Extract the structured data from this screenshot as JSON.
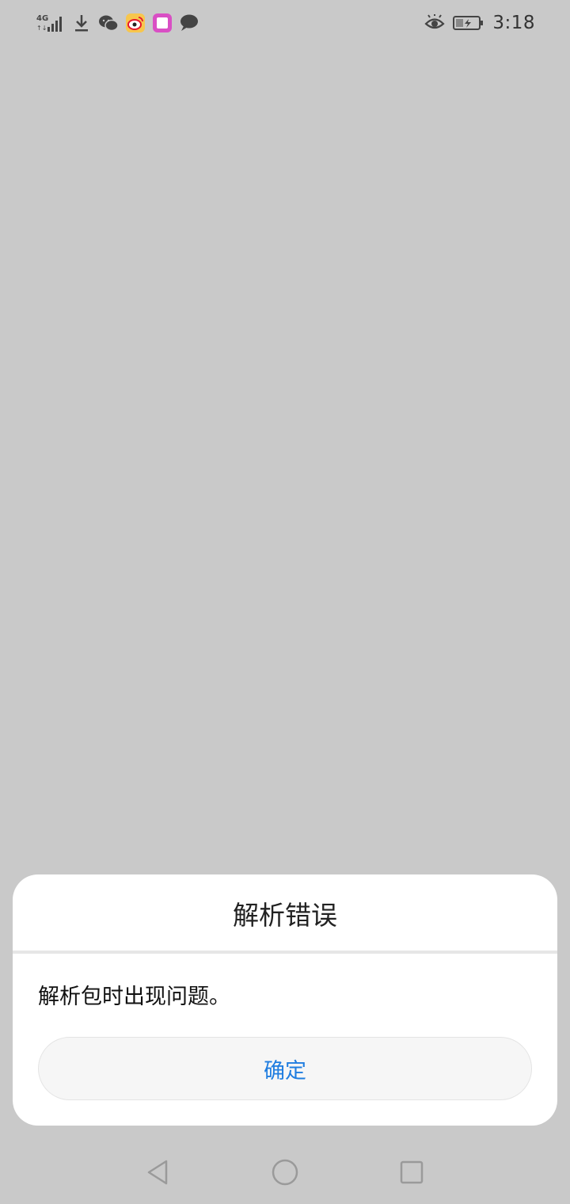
{
  "status_bar": {
    "network_label": "4G",
    "time": "3:18",
    "left_icons": [
      "signal-icon",
      "download-icon",
      "wechat-icon",
      "weibo-icon",
      "app-icon",
      "message-icon"
    ],
    "right_icons": [
      "eye-icon",
      "battery-charging-icon"
    ]
  },
  "dialog": {
    "title": "解析错误",
    "message": "解析包时出现问题。",
    "confirm_label": "确定"
  },
  "nav_bar": {
    "icons": [
      "back-icon",
      "home-icon",
      "recents-icon"
    ]
  },
  "colors": {
    "background": "#c9c9c9",
    "dialog": "#ffffff",
    "accent": "#1f7de0",
    "weibo": "#e6162d",
    "app": "#d94fc4"
  }
}
